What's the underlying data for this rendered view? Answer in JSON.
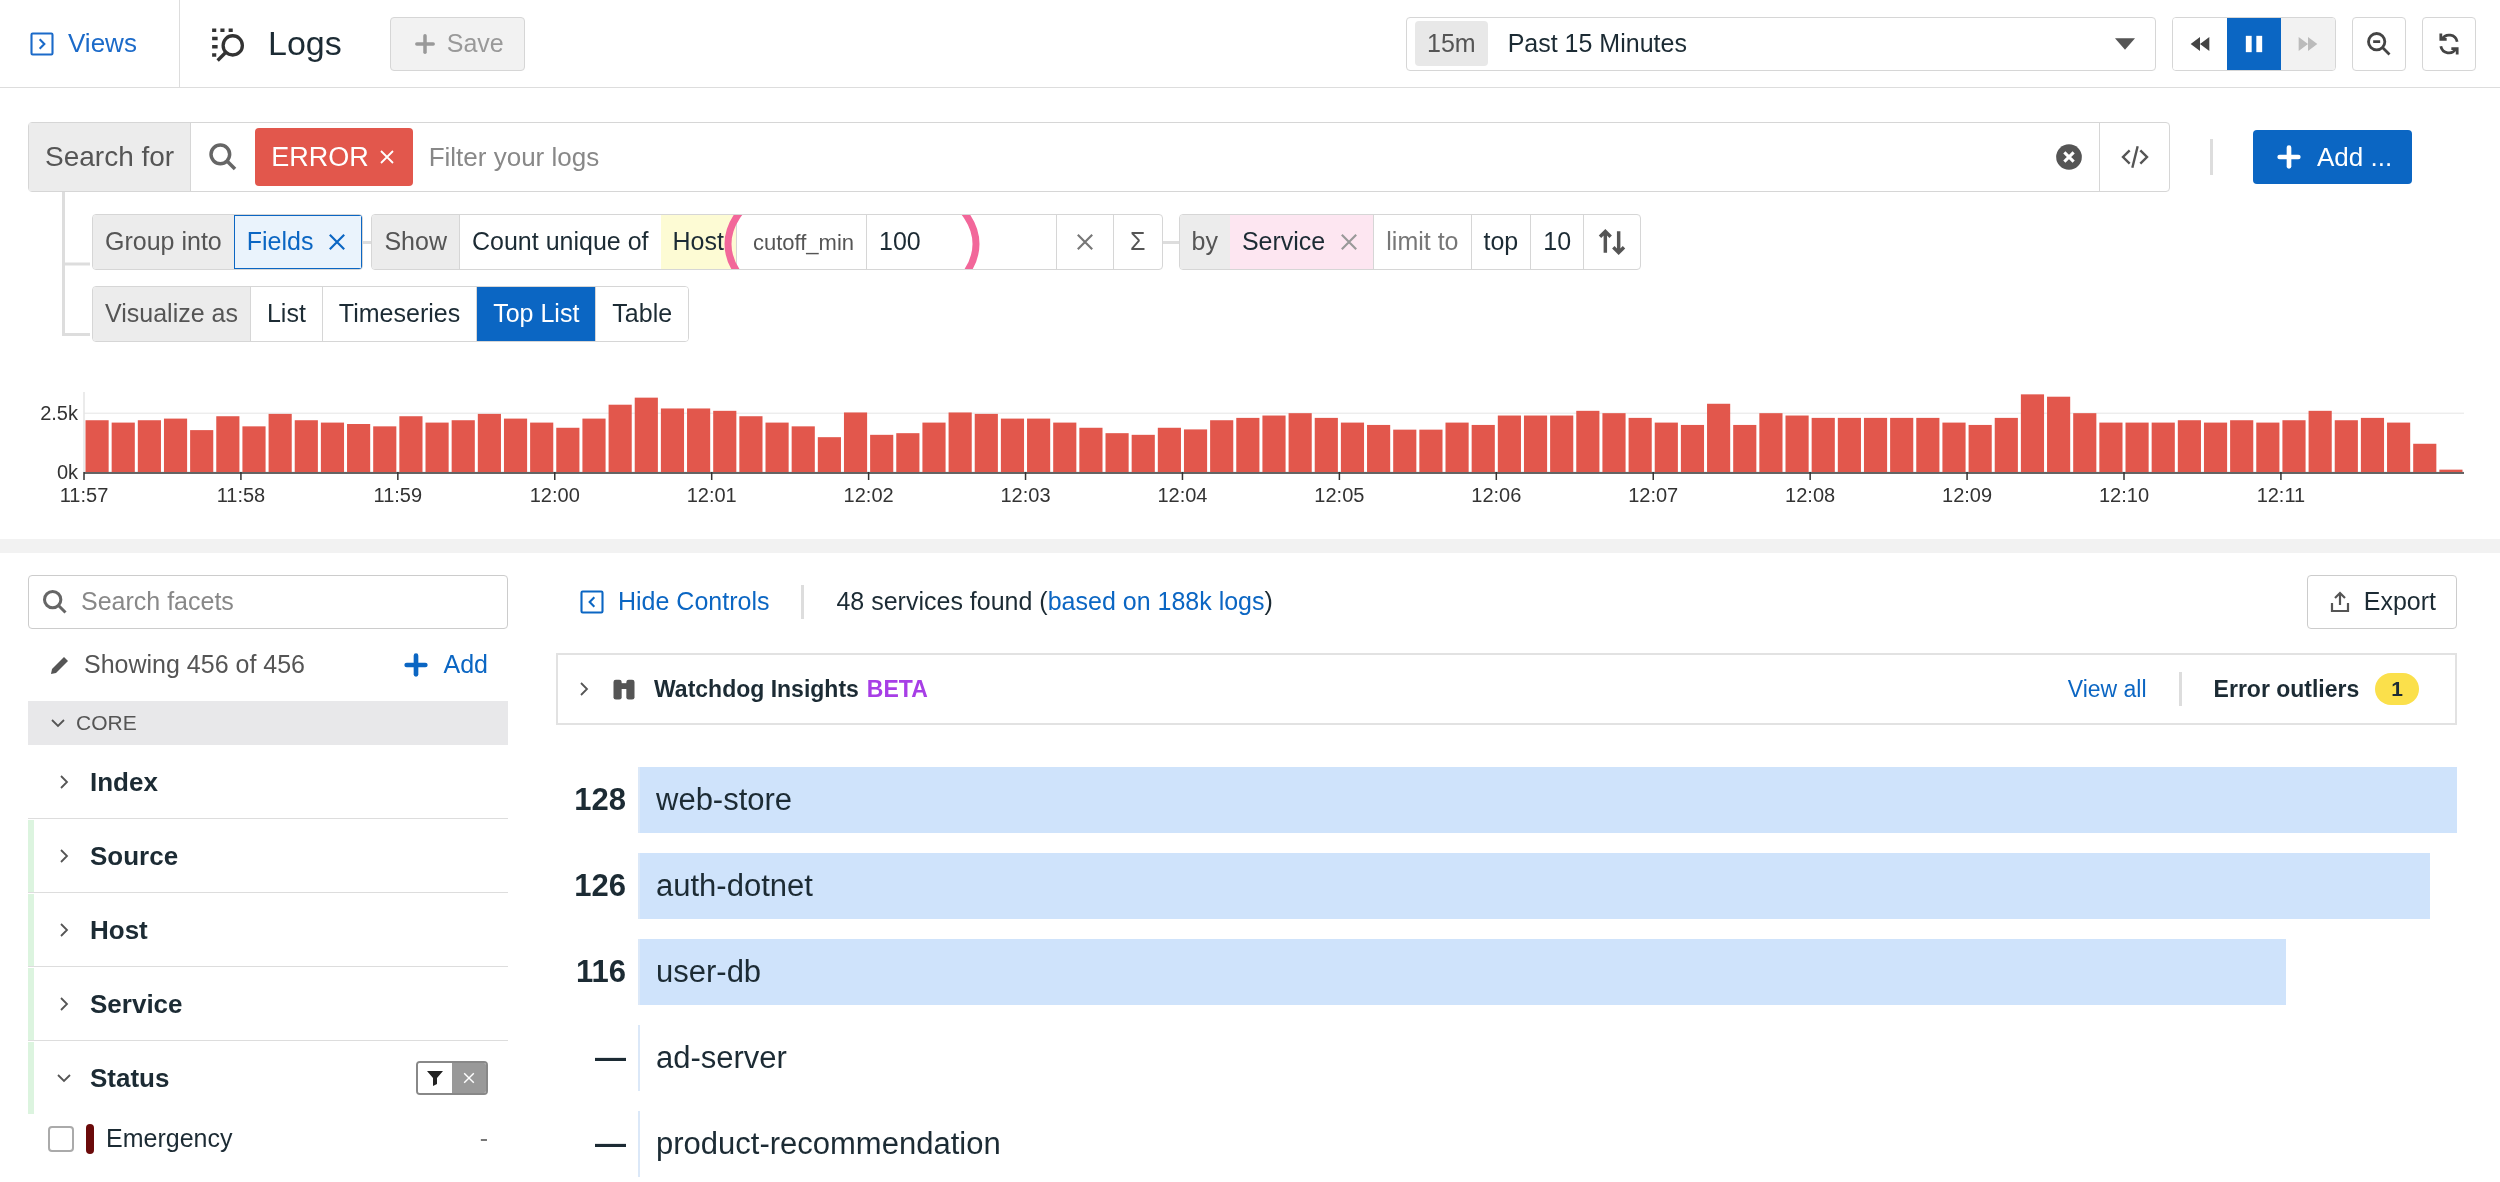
{
  "header": {
    "views_label": "Views",
    "title": "Logs",
    "save_label": "Save",
    "save_disabled": true,
    "time_badge": "15m",
    "time_range": "Past 15 Minutes",
    "playback": [
      {
        "kind": "rewind",
        "selected": false,
        "disabled": false
      },
      {
        "kind": "pause",
        "selected": true,
        "disabled": false
      },
      {
        "kind": "forward",
        "selected": false,
        "disabled": true
      }
    ]
  },
  "search": {
    "label": "Search for",
    "tags": [
      {
        "text": "ERROR"
      }
    ],
    "placeholder": "Filter your logs",
    "add_label": "Add ..."
  },
  "group": {
    "label": "Group into",
    "value": "Fields",
    "show_label": "Show",
    "measure": "Count unique of",
    "measure_field": "Host",
    "option_label": "cutoff_min",
    "option_value": "100",
    "sum_symbol": "Σ",
    "by_label": "by",
    "by_field": "Service",
    "limit_label": "limit to",
    "limit_mode": "top",
    "limit_value": "10"
  },
  "visualize": {
    "label": "Visualize as",
    "options": [
      {
        "label": "List",
        "selected": false
      },
      {
        "label": "Timeseries",
        "selected": false
      },
      {
        "label": "Top List",
        "selected": true
      },
      {
        "label": "Table",
        "selected": false
      }
    ]
  },
  "chart_data": {
    "type": "bar",
    "ylim": [
      0,
      3400
    ],
    "yticks": [
      {
        "value": 0,
        "label": "0k"
      },
      {
        "value": 2500,
        "label": "2.5k"
      }
    ],
    "categories": [
      "11:57",
      null,
      null,
      null,
      null,
      null,
      "11:58",
      null,
      null,
      null,
      null,
      null,
      "11:59",
      null,
      null,
      null,
      null,
      null,
      "12:00",
      null,
      null,
      null,
      null,
      null,
      "12:01",
      null,
      null,
      null,
      null,
      null,
      "12:02",
      null,
      null,
      null,
      null,
      null,
      "12:03",
      null,
      null,
      null,
      null,
      null,
      "12:04",
      null,
      null,
      null,
      null,
      null,
      "12:05",
      null,
      null,
      null,
      null,
      null,
      "12:06",
      null,
      null,
      null,
      null,
      null,
      "12:07",
      null,
      null,
      null,
      null,
      null,
      "12:08",
      null,
      null,
      null,
      null,
      null,
      "12:09",
      null,
      null,
      null,
      null,
      null,
      "12:10",
      null,
      null,
      null,
      null,
      null,
      "12:11",
      null,
      null,
      null,
      null,
      null,
      null
    ],
    "series": [
      {
        "color": "#e2574c",
        "values": [
          2200,
          2100,
          2200,
          2270,
          1780,
          2370,
          1940,
          2470,
          2200,
          2100,
          2040,
          1940,
          2370,
          2100,
          2200,
          2470,
          2270,
          2100,
          1880,
          2270,
          2860,
          3160,
          2700,
          2700,
          2600,
          2370,
          2100,
          1940,
          1480,
          2530,
          1580,
          1650,
          2100,
          2530,
          2470,
          2270,
          2270,
          2100,
          1880,
          1650,
          1580,
          1880,
          1810,
          2200,
          2300,
          2400,
          2500,
          2300,
          2100,
          2000,
          1800,
          1800,
          2100,
          2000,
          2400,
          2400,
          2400,
          2600,
          2500,
          2300,
          2100,
          2000,
          2900,
          2000,
          2500,
          2400,
          2300,
          2300,
          2300,
          2300,
          2300,
          2100,
          2000,
          2300,
          3300,
          3200,
          2500,
          2100,
          2100,
          2100,
          2200,
          2100,
          2200,
          2100,
          2200,
          2600,
          2200,
          2300,
          2100,
          1200,
          100
        ]
      }
    ]
  },
  "facets": {
    "placeholder": "Search facets",
    "showing": "Showing 456 of 456",
    "add_label": "Add",
    "section": {
      "label": "CORE",
      "expanded": true
    },
    "items": [
      {
        "label": "Index",
        "expanded": false,
        "highlighted": false
      },
      {
        "label": "Source",
        "expanded": false,
        "highlighted": true
      },
      {
        "label": "Host",
        "expanded": false,
        "highlighted": true
      },
      {
        "label": "Service",
        "expanded": false,
        "highlighted": true
      },
      {
        "label": "Status",
        "expanded": true,
        "highlighted": true,
        "values": [
          {
            "label": "Emergency",
            "checked": false,
            "color": "#6b0a0a",
            "count": "-"
          }
        ]
      }
    ]
  },
  "results": {
    "hide_controls": "Hide Controls",
    "summary_start": "48 services found (",
    "summary_link": "based on 188k logs",
    "summary_end": ")",
    "export_label": "Export"
  },
  "watchdog": {
    "expanded": false,
    "title": "Watchdog Insights",
    "badge": "BETA",
    "view_all": "View all",
    "outliers_label": "Error outliers",
    "outliers_count": "1"
  },
  "toplist": [
    {
      "value": "128",
      "name": "web-store",
      "level": 1
    },
    {
      "value": "126",
      "name": "auth-dotnet",
      "level": 0.985
    },
    {
      "value": "116",
      "name": "user-db",
      "level": 0.906
    },
    {
      "value": "—",
      "name": "ad-server"
    },
    {
      "value": "—",
      "name": "product-recommendation"
    }
  ]
}
